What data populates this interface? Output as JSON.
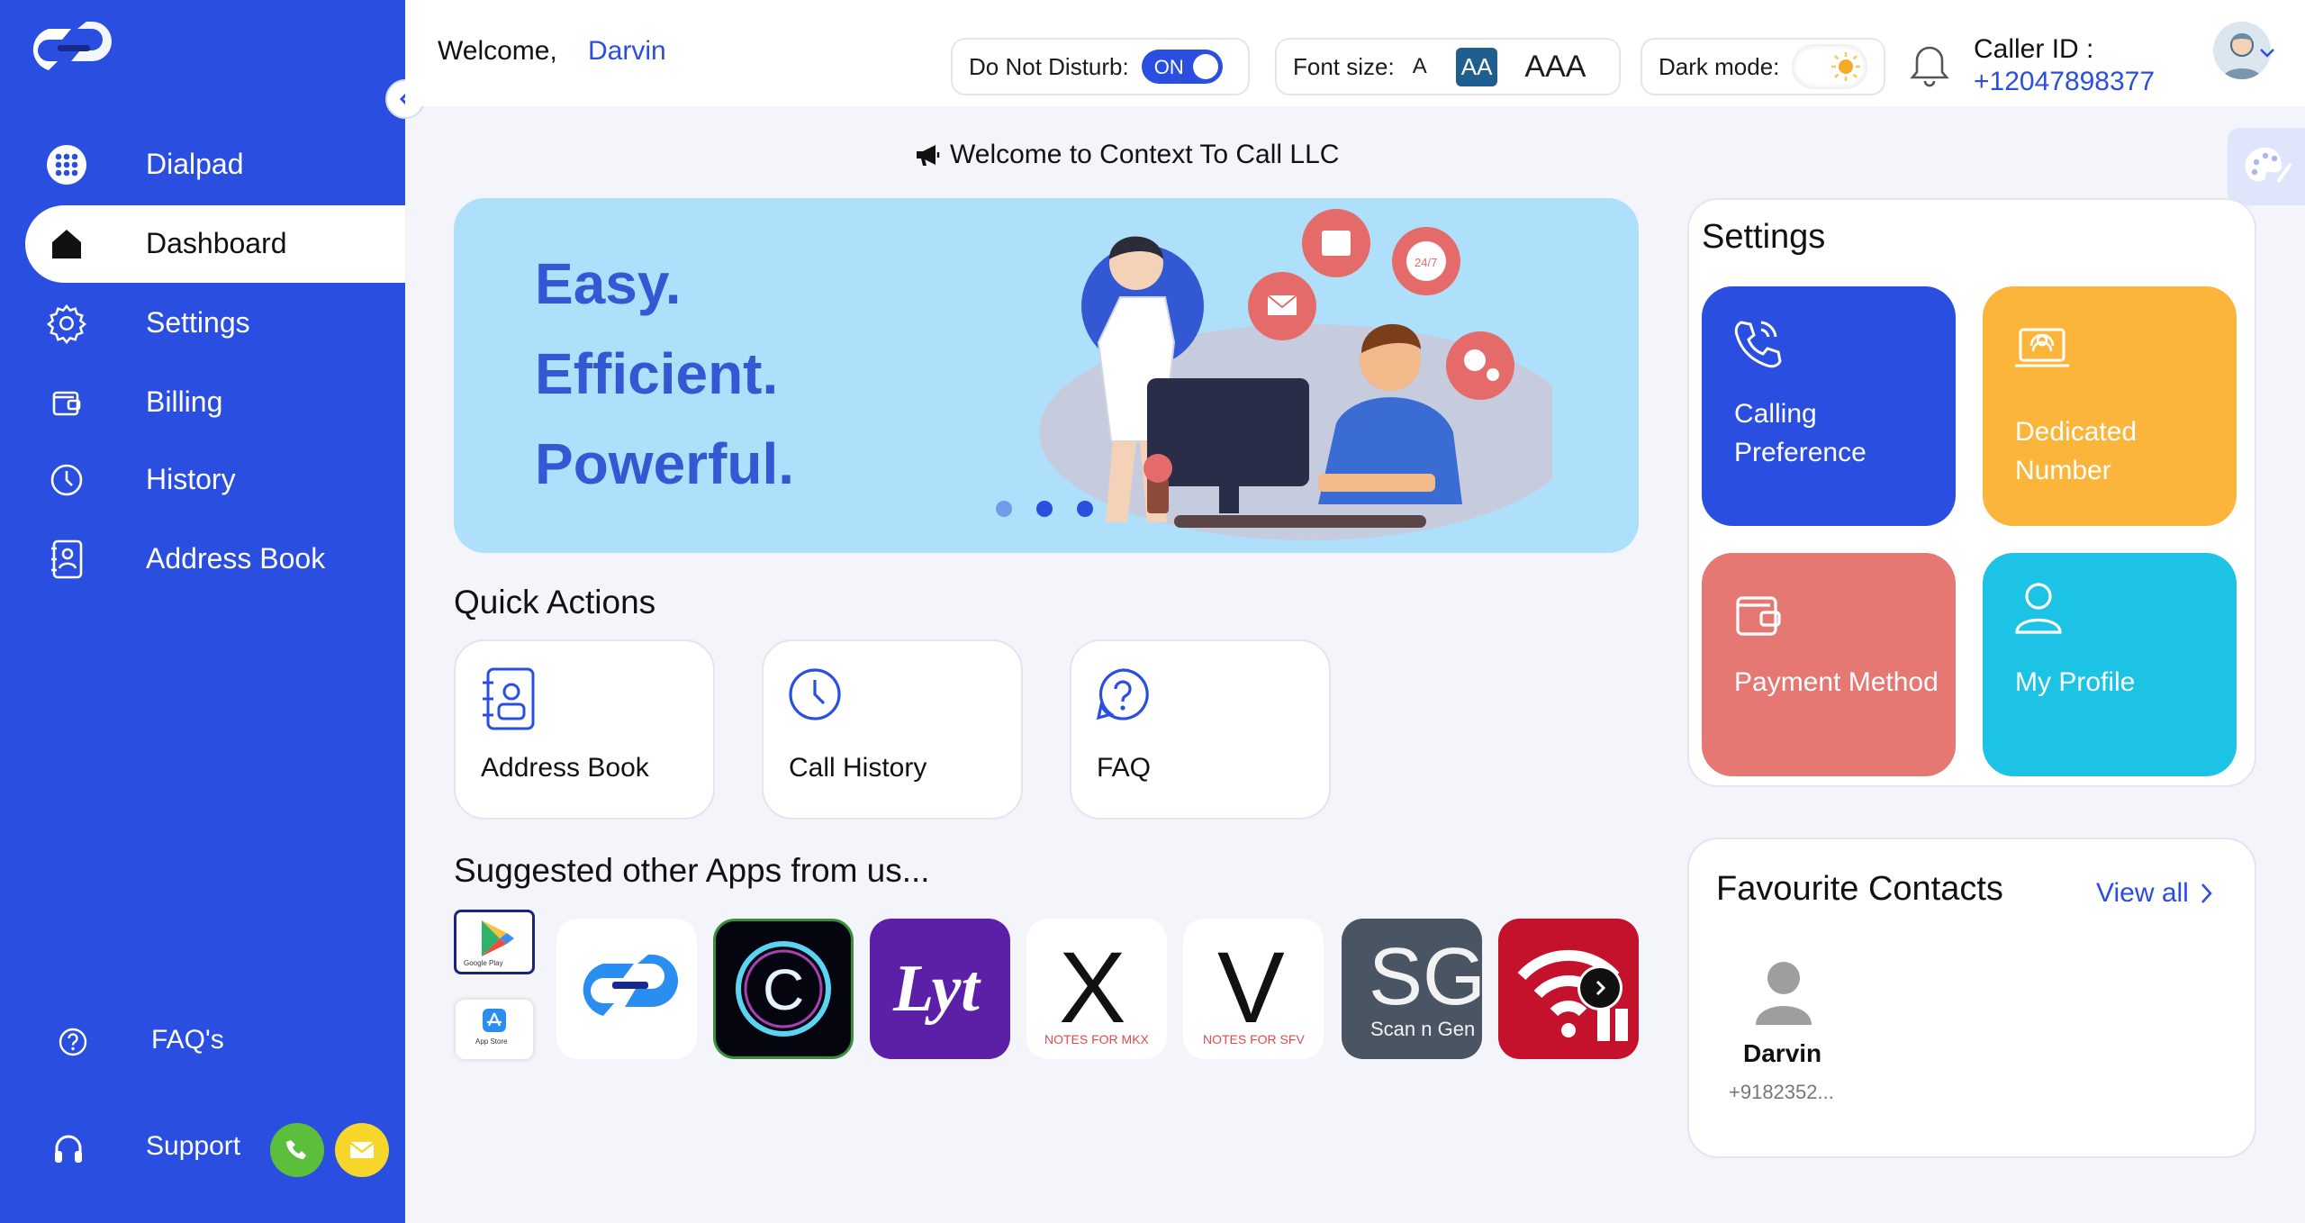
{
  "sidebar": {
    "nav": [
      {
        "label": "Dialpad",
        "icon": "dialpad-icon"
      },
      {
        "label": "Dashboard",
        "icon": "home-icon"
      },
      {
        "label": "Settings",
        "icon": "gear-icon"
      },
      {
        "label": "Billing",
        "icon": "wallet-icon"
      },
      {
        "label": "History",
        "icon": "clock-icon"
      },
      {
        "label": "Address Book",
        "icon": "contact-book-icon"
      }
    ],
    "faq_label": "FAQ's",
    "support_label": "Support"
  },
  "header": {
    "welcome_prefix": "Welcome,",
    "user_name": "Darvin",
    "dnd_label": "Do Not Disturb:",
    "dnd_state": "ON",
    "font_size_label": "Font size:",
    "font_sizes": [
      "A",
      "AA",
      "AAA"
    ],
    "selected_font_size": "AA",
    "dark_mode_label": "Dark mode:",
    "caller_id_label": "Caller ID :",
    "caller_id_number": "+12047898377"
  },
  "announcement": "Welcome to Context To Call LLC",
  "banner": {
    "lines": [
      "Easy.",
      "Efficient.",
      "Powerful."
    ],
    "slide_count": 3,
    "active_slide": 2,
    "clock_badge": "24/7"
  },
  "quick_actions": {
    "title": "Quick Actions",
    "items": [
      {
        "label": "Address Book",
        "icon": "contact-book-icon"
      },
      {
        "label": "Call History",
        "icon": "clock-icon"
      },
      {
        "label": "FAQ",
        "icon": "question-icon"
      }
    ]
  },
  "suggested_apps": {
    "title": "Suggested other Apps from us...",
    "store_badges": [
      "Google Play",
      "App Store"
    ],
    "apps": [
      {
        "name": "Context To Call",
        "text": ""
      },
      {
        "name": "C app",
        "text": "C"
      },
      {
        "name": "Lyt",
        "text": "Lyt"
      },
      {
        "name": "Notes for MKX",
        "text": "X",
        "caption": "NOTES FOR MKX"
      },
      {
        "name": "Notes for SFV",
        "text": "V",
        "caption": "NOTES FOR SFV"
      },
      {
        "name": "Scan n Gen",
        "text": "SG",
        "caption": "Scan n Gen"
      },
      {
        "name": "WiFi app",
        "text": ""
      }
    ]
  },
  "settings_panel": {
    "title": "Settings",
    "tiles": [
      {
        "label": "Calling Preference",
        "color": "#2a4fe0",
        "icon": "phone-call-icon"
      },
      {
        "label": "Dedicated Number",
        "color": "#fcb53b",
        "icon": "laptop-support-icon"
      },
      {
        "label": "Payment Method",
        "color": "#e57873",
        "icon": "wallet-icon"
      },
      {
        "label": "My Profile",
        "color": "#1dc3e4",
        "icon": "user-icon"
      }
    ]
  },
  "favourites": {
    "title": "Favourite Contacts",
    "view_all": "View all",
    "contacts": [
      {
        "name": "Darvin",
        "phone": "+9182352..."
      }
    ]
  },
  "colors": {
    "primary": "#2a4fe0",
    "sidebar": "#2a4fe0",
    "banner_bg": "#aee0fb",
    "banner_text": "#3358d4",
    "support_phone": "#5bbf3c",
    "support_mail": "#f6d62a"
  }
}
